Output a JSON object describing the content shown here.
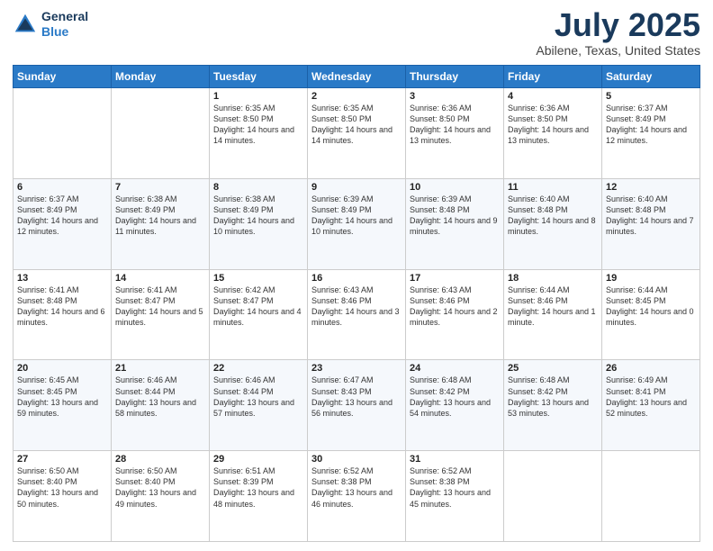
{
  "header": {
    "logo_line1": "General",
    "logo_line2": "Blue",
    "title": "July 2025",
    "subtitle": "Abilene, Texas, United States"
  },
  "days_of_week": [
    "Sunday",
    "Monday",
    "Tuesday",
    "Wednesday",
    "Thursday",
    "Friday",
    "Saturday"
  ],
  "weeks": [
    [
      {
        "day": "",
        "info": ""
      },
      {
        "day": "",
        "info": ""
      },
      {
        "day": "1",
        "info": "Sunrise: 6:35 AM\nSunset: 8:50 PM\nDaylight: 14 hours and 14 minutes."
      },
      {
        "day": "2",
        "info": "Sunrise: 6:35 AM\nSunset: 8:50 PM\nDaylight: 14 hours and 14 minutes."
      },
      {
        "day": "3",
        "info": "Sunrise: 6:36 AM\nSunset: 8:50 PM\nDaylight: 14 hours and 13 minutes."
      },
      {
        "day": "4",
        "info": "Sunrise: 6:36 AM\nSunset: 8:50 PM\nDaylight: 14 hours and 13 minutes."
      },
      {
        "day": "5",
        "info": "Sunrise: 6:37 AM\nSunset: 8:49 PM\nDaylight: 14 hours and 12 minutes."
      }
    ],
    [
      {
        "day": "6",
        "info": "Sunrise: 6:37 AM\nSunset: 8:49 PM\nDaylight: 14 hours and 12 minutes."
      },
      {
        "day": "7",
        "info": "Sunrise: 6:38 AM\nSunset: 8:49 PM\nDaylight: 14 hours and 11 minutes."
      },
      {
        "day": "8",
        "info": "Sunrise: 6:38 AM\nSunset: 8:49 PM\nDaylight: 14 hours and 10 minutes."
      },
      {
        "day": "9",
        "info": "Sunrise: 6:39 AM\nSunset: 8:49 PM\nDaylight: 14 hours and 10 minutes."
      },
      {
        "day": "10",
        "info": "Sunrise: 6:39 AM\nSunset: 8:48 PM\nDaylight: 14 hours and 9 minutes."
      },
      {
        "day": "11",
        "info": "Sunrise: 6:40 AM\nSunset: 8:48 PM\nDaylight: 14 hours and 8 minutes."
      },
      {
        "day": "12",
        "info": "Sunrise: 6:40 AM\nSunset: 8:48 PM\nDaylight: 14 hours and 7 minutes."
      }
    ],
    [
      {
        "day": "13",
        "info": "Sunrise: 6:41 AM\nSunset: 8:48 PM\nDaylight: 14 hours and 6 minutes."
      },
      {
        "day": "14",
        "info": "Sunrise: 6:41 AM\nSunset: 8:47 PM\nDaylight: 14 hours and 5 minutes."
      },
      {
        "day": "15",
        "info": "Sunrise: 6:42 AM\nSunset: 8:47 PM\nDaylight: 14 hours and 4 minutes."
      },
      {
        "day": "16",
        "info": "Sunrise: 6:43 AM\nSunset: 8:46 PM\nDaylight: 14 hours and 3 minutes."
      },
      {
        "day": "17",
        "info": "Sunrise: 6:43 AM\nSunset: 8:46 PM\nDaylight: 14 hours and 2 minutes."
      },
      {
        "day": "18",
        "info": "Sunrise: 6:44 AM\nSunset: 8:46 PM\nDaylight: 14 hours and 1 minute."
      },
      {
        "day": "19",
        "info": "Sunrise: 6:44 AM\nSunset: 8:45 PM\nDaylight: 14 hours and 0 minutes."
      }
    ],
    [
      {
        "day": "20",
        "info": "Sunrise: 6:45 AM\nSunset: 8:45 PM\nDaylight: 13 hours and 59 minutes."
      },
      {
        "day": "21",
        "info": "Sunrise: 6:46 AM\nSunset: 8:44 PM\nDaylight: 13 hours and 58 minutes."
      },
      {
        "day": "22",
        "info": "Sunrise: 6:46 AM\nSunset: 8:44 PM\nDaylight: 13 hours and 57 minutes."
      },
      {
        "day": "23",
        "info": "Sunrise: 6:47 AM\nSunset: 8:43 PM\nDaylight: 13 hours and 56 minutes."
      },
      {
        "day": "24",
        "info": "Sunrise: 6:48 AM\nSunset: 8:42 PM\nDaylight: 13 hours and 54 minutes."
      },
      {
        "day": "25",
        "info": "Sunrise: 6:48 AM\nSunset: 8:42 PM\nDaylight: 13 hours and 53 minutes."
      },
      {
        "day": "26",
        "info": "Sunrise: 6:49 AM\nSunset: 8:41 PM\nDaylight: 13 hours and 52 minutes."
      }
    ],
    [
      {
        "day": "27",
        "info": "Sunrise: 6:50 AM\nSunset: 8:40 PM\nDaylight: 13 hours and 50 minutes."
      },
      {
        "day": "28",
        "info": "Sunrise: 6:50 AM\nSunset: 8:40 PM\nDaylight: 13 hours and 49 minutes."
      },
      {
        "day": "29",
        "info": "Sunrise: 6:51 AM\nSunset: 8:39 PM\nDaylight: 13 hours and 48 minutes."
      },
      {
        "day": "30",
        "info": "Sunrise: 6:52 AM\nSunset: 8:38 PM\nDaylight: 13 hours and 46 minutes."
      },
      {
        "day": "31",
        "info": "Sunrise: 6:52 AM\nSunset: 8:38 PM\nDaylight: 13 hours and 45 minutes."
      },
      {
        "day": "",
        "info": ""
      },
      {
        "day": "",
        "info": ""
      }
    ]
  ]
}
